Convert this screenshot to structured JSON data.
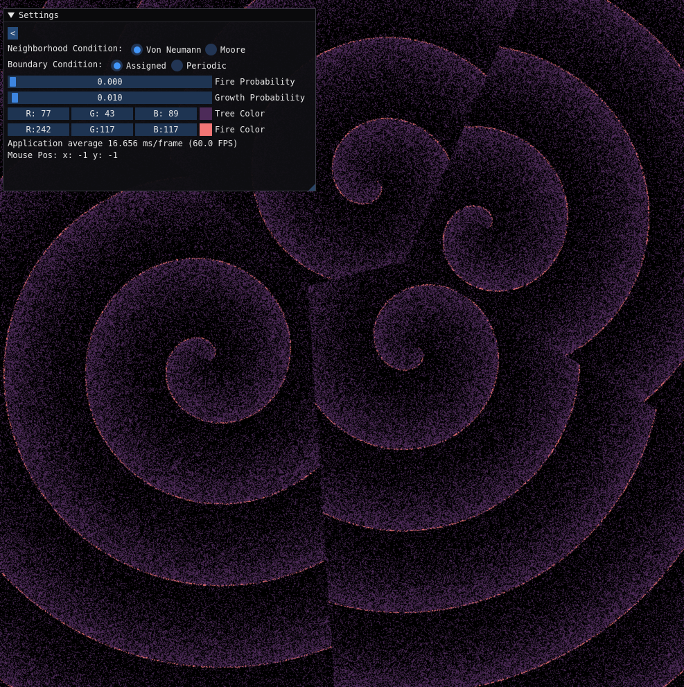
{
  "window": {
    "title": "Settings"
  },
  "back_button": {
    "label": "<"
  },
  "neighborhood": {
    "label": "Neighborhood Condition:",
    "options": [
      {
        "label": "Von Neumann",
        "selected": true
      },
      {
        "label": "Moore",
        "selected": false
      }
    ]
  },
  "boundary": {
    "label": "Boundary Condition:",
    "options": [
      {
        "label": "Assigned",
        "selected": true
      },
      {
        "label": "Periodic",
        "selected": false
      }
    ]
  },
  "fire_probability": {
    "value_text": "0.000",
    "value": 0.0,
    "label": "Fire Probability"
  },
  "growth_probability": {
    "value_text": "0.010",
    "value": 0.01,
    "label": "Growth Probability"
  },
  "tree_color": {
    "r": "R: 77",
    "g": "G: 43",
    "b": "B: 89",
    "label": "Tree Color",
    "hex": "#4d2b59"
  },
  "fire_color": {
    "r": "R:242",
    "g": "G:117",
    "b": "B:117",
    "label": "Fire Color",
    "hex": "#f27575"
  },
  "stats": {
    "fps_text": "Application average 16.656 ms/frame (60.0 FPS)",
    "mouse_text": "Mouse Pos: x: -1 y: -1"
  },
  "colors": {
    "background": "#000000",
    "accent": "#4296fa",
    "frame_bg": "#1e3452",
    "title_bg": "#0a0a0c"
  }
}
